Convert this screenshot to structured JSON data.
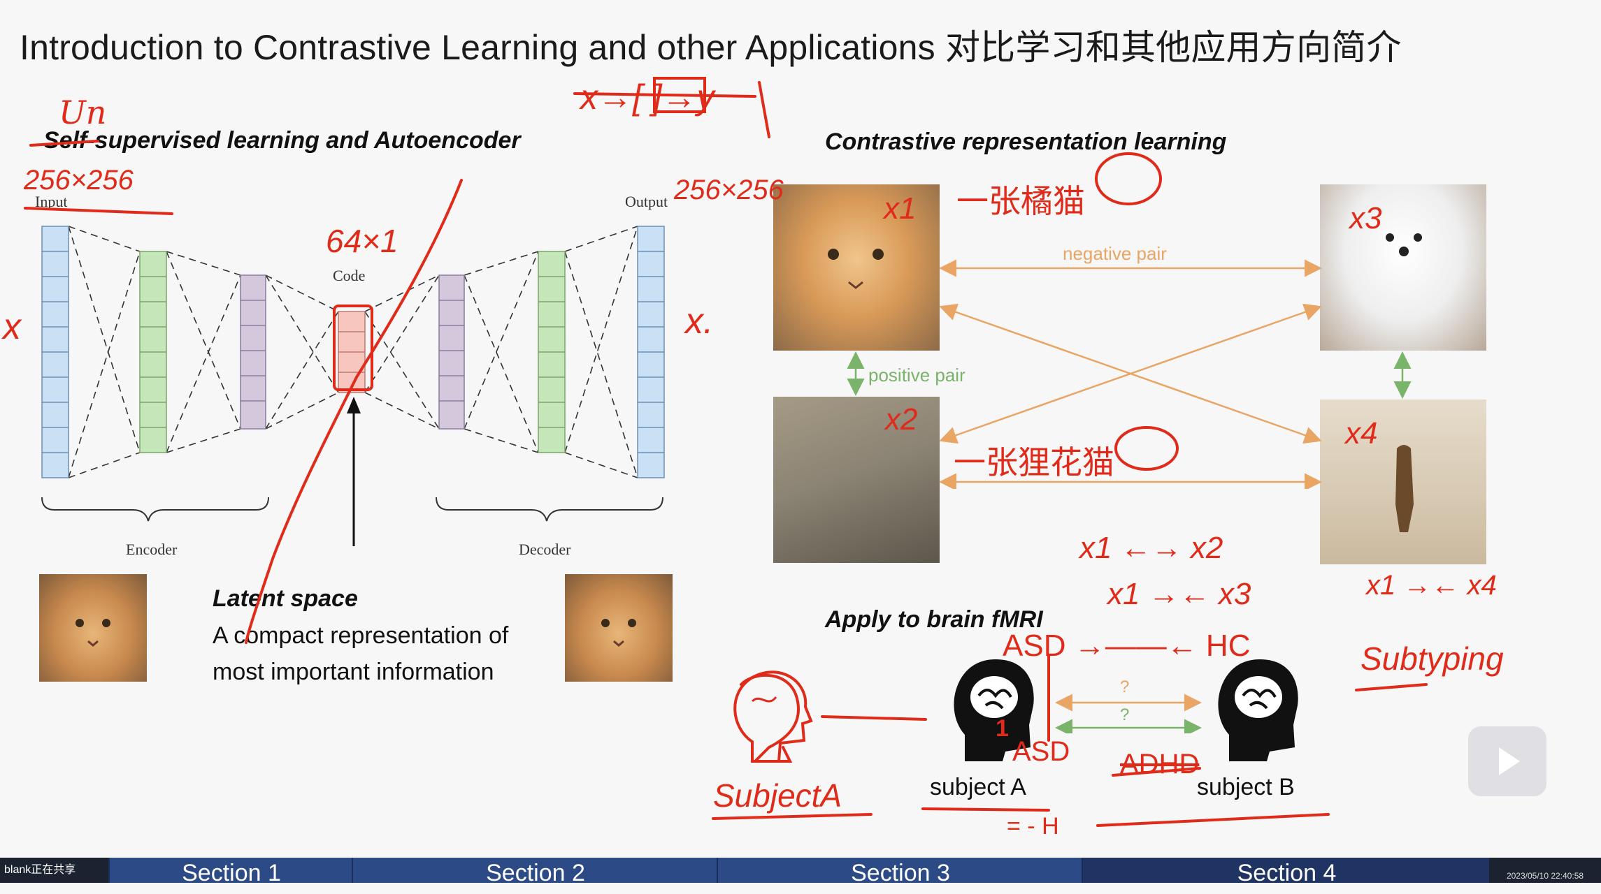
{
  "slide": {
    "title": "Introduction to Contrastive Learning and other Applications 对比学习和其他应用方向简介",
    "left_heading": "Self-supervised learning and Autoencoder",
    "right_heading": "Contrastive representation learning",
    "brain_heading": "Apply to brain fMRI",
    "autoencoder": {
      "input_label": "Input",
      "output_label": "Output",
      "code_label": "Code",
      "encoder_label": "Encoder",
      "decoder_label": "Decoder"
    },
    "latent": {
      "title": "Latent space",
      "description": "A compact representation of most important information"
    },
    "pairs": {
      "negative": "negative pair",
      "positive": "positive pair",
      "question1": "?",
      "question2": "?"
    },
    "subjects": {
      "a": "subject A",
      "b": "subject B"
    },
    "colors": {
      "input_layer": "#c9e0f5",
      "encoder_layer": "#c5e6b8",
      "hidden_layer": "#d3c8dc",
      "code_layer": "#f6c6bf",
      "negative": "#e8a564",
      "positive": "#7ab36a",
      "ink": "#e02a1a"
    }
  },
  "annotations": {
    "un": "Un",
    "input_size": "256×256",
    "output_size": "256×256",
    "code_size": "64×1",
    "x_left": "x",
    "x_right": "x.",
    "mapping": "x→[ ]→y",
    "x1": "x1",
    "x2": "x2",
    "x3": "x3",
    "x4": "x4",
    "cn1": "一张橘猫",
    "cn2": "一张狸花猫",
    "rel1": "x1 ←→ x2",
    "rel2": "x1 →← x3",
    "rel3": "x1 →← x4",
    "asd_hc": "ASD →——← HC",
    "asd_top": "ASD",
    "asd_bottom": "ASD",
    "adhd": "ADHD",
    "subject_hand": "SubjectA",
    "subtyping": "Subtyping",
    "one": "1",
    "h_mark": "= - H"
  },
  "taskbar": {
    "share_text": "blank正在共享",
    "sections": [
      "Section 1",
      "Section 2",
      "Section 3",
      "Section 4"
    ],
    "timestamp": "2023/05/10 22:40:58"
  }
}
